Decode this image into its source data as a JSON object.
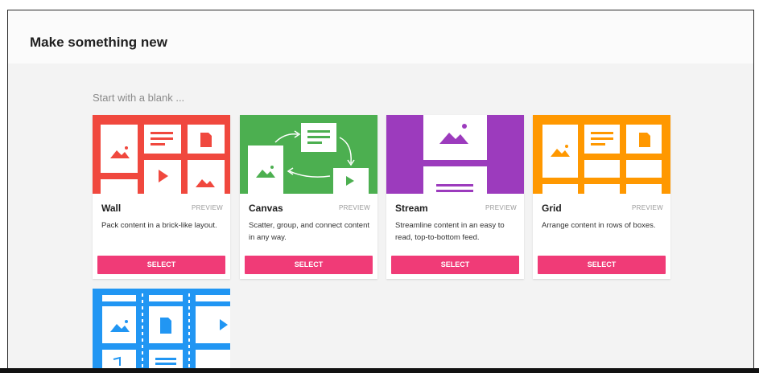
{
  "dialog": {
    "title": "Make something new",
    "subtitle": "Start with a blank ..."
  },
  "colors": {
    "wall": "#f0483e",
    "canvas": "#4caf50",
    "stream": "#9c3bbd",
    "grid": "#ff9800",
    "shelf": "#2196f3",
    "select": "#f03b77"
  },
  "cards": [
    {
      "name": "Wall",
      "preview": "PREVIEW",
      "desc": "Pack content in a brick-like layout.",
      "select": "SELECT"
    },
    {
      "name": "Canvas",
      "preview": "PREVIEW",
      "desc": "Scatter, group, and connect content in any way.",
      "select": "SELECT"
    },
    {
      "name": "Stream",
      "preview": "PREVIEW",
      "desc": "Streamline content in an easy to read, top-to-bottom feed.",
      "select": "SELECT"
    },
    {
      "name": "Grid",
      "preview": "PREVIEW",
      "desc": "Arrange content in rows of boxes.",
      "select": "SELECT"
    }
  ]
}
